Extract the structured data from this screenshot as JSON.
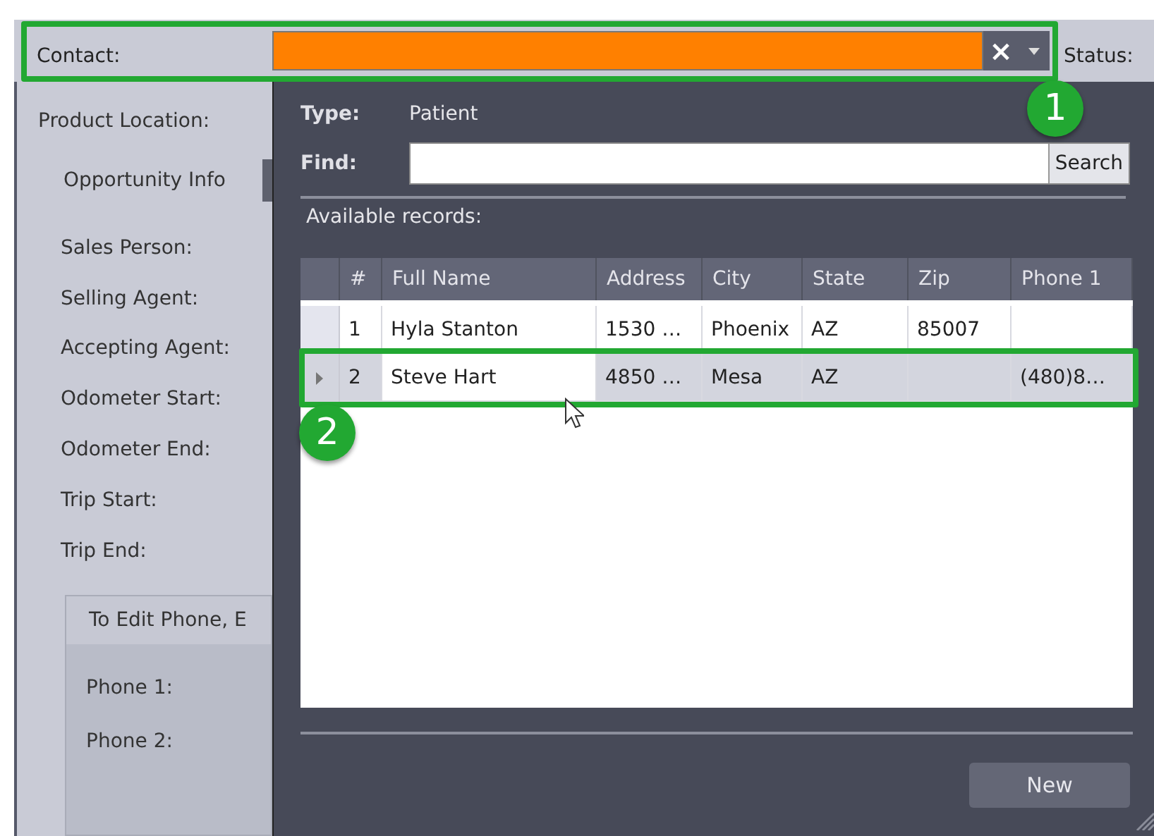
{
  "contact": {
    "label": "Contact:",
    "highlighted": true,
    "clear": "×",
    "status_label": "Status:"
  },
  "callouts": [
    {
      "number": "1"
    },
    {
      "number": "2"
    }
  ],
  "sidebar": {
    "top_fields": [
      "Product Location:"
    ],
    "tab": {
      "label": "Opportunity Info",
      "selected": true
    },
    "fields": [
      "Sales Person:",
      "Selling Agent:",
      "Accepting Agent:",
      "Odometer Start:",
      "Odometer End:",
      "Trip Start:",
      "Trip End:"
    ],
    "group": {
      "title": "To Edit Phone, E",
      "fields": [
        "Phone 1:",
        "Phone 2:"
      ]
    }
  },
  "picker": {
    "type_label": "Type:",
    "type_value": "Patient",
    "find_label": "Find:",
    "search_button": "Search",
    "records_label": "Available records:",
    "columns": [
      "#",
      "Full Name",
      "Address",
      "City",
      "State",
      "Zip",
      "Phone 1"
    ],
    "rows": [
      {
        "selected": false,
        "cells": [
          "1",
          "Hyla Stanton",
          "1530 …",
          "Phoenix",
          "AZ",
          "85007",
          ""
        ]
      },
      {
        "selected": true,
        "cells": [
          "2",
          "Steve Hart",
          "4850 …",
          "Mesa",
          "AZ",
          "",
          "(480)8…"
        ]
      }
    ],
    "new_button": "New"
  }
}
